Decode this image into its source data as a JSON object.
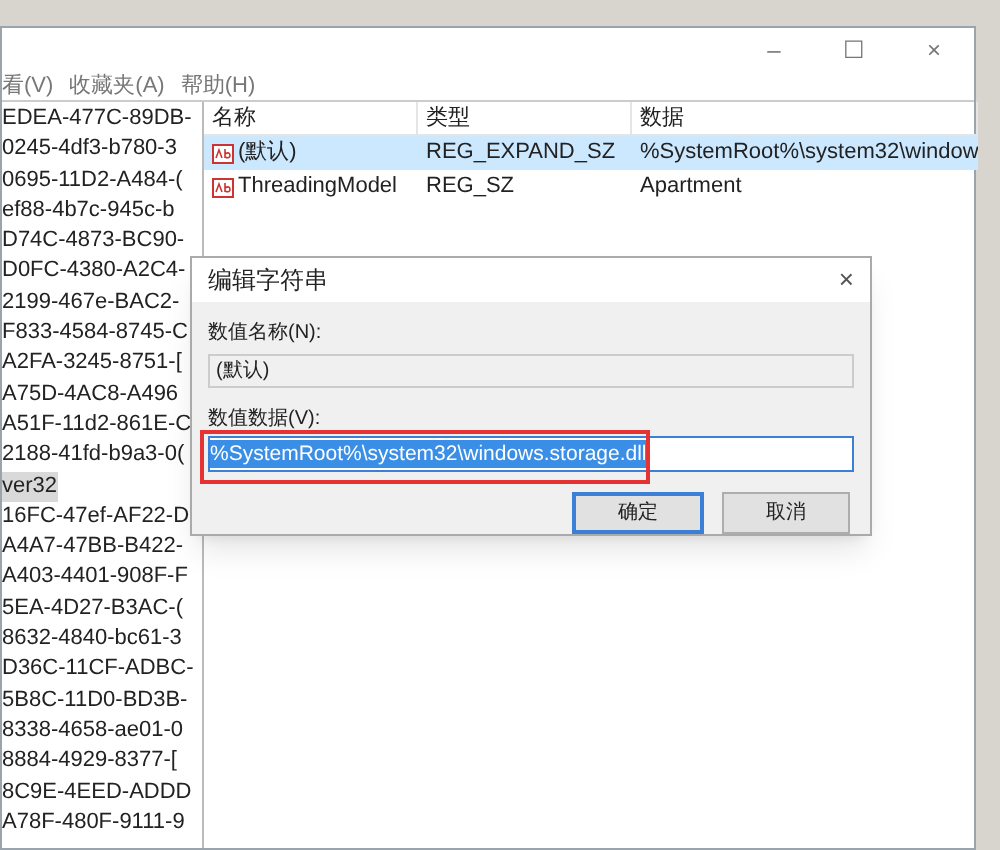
{
  "window": {
    "controls": [
      "–",
      "☐",
      "×"
    ]
  },
  "menu": [
    "看(V)",
    "收藏夹(A)",
    "帮助(H)"
  ],
  "tree": [
    {
      "label": "EDEA-477C-89DB-",
      "selected": false
    },
    {
      "label": "0245-4df3-b780-3",
      "selected": false
    },
    {
      "label": "0695-11D2-A484-(",
      "selected": false
    },
    {
      "label": "ef88-4b7c-945c-b",
      "selected": false
    },
    {
      "label": "D74C-4873-BC90-",
      "selected": false
    },
    {
      "label": "D0FC-4380-A2C4-",
      "selected": false
    },
    {
      "label": "2199-467e-BAC2-",
      "selected": false
    },
    {
      "label": "F833-4584-8745-C",
      "selected": false
    },
    {
      "label": "A2FA-3245-8751-[",
      "selected": false
    },
    {
      "label": "A75D-4AC8-A496",
      "selected": false
    },
    {
      "label": "A51F-11d2-861E-C",
      "selected": false
    },
    {
      "label": "2188-41fd-b9a3-0(",
      "selected": false
    },
    {
      "label": "ver32",
      "selected": true
    },
    {
      "label": "16FC-47ef-AF22-D",
      "selected": false
    },
    {
      "label": "A4A7-47BB-B422-",
      "selected": false
    },
    {
      "label": "A403-4401-908F-F",
      "selected": false
    },
    {
      "label": "5EA-4D27-B3AC-(",
      "selected": false
    },
    {
      "label": "8632-4840-bc61-3",
      "selected": false
    },
    {
      "label": "D36C-11CF-ADBC-",
      "selected": false
    },
    {
      "label": "5B8C-11D0-BD3B-",
      "selected": false
    },
    {
      "label": "8338-4658-ae01-0",
      "selected": false
    },
    {
      "label": "8884-4929-8377-[",
      "selected": false
    },
    {
      "label": "8C9E-4EED-ADDD",
      "selected": false
    },
    {
      "label": "A78F-480F-9111-9",
      "selected": false
    }
  ],
  "table": {
    "columns": [
      "名称",
      "类型",
      "数据"
    ],
    "rows": [
      {
        "name": "(默认)",
        "type": "REG_EXPAND_SZ",
        "data": "%SystemRoot%\\system32\\window",
        "selected": true
      },
      {
        "name": "ThreadingModel",
        "type": "REG_SZ",
        "data": "Apartment",
        "selected": false
      }
    ]
  },
  "dialog": {
    "title": "编辑字符串",
    "close": "×",
    "name_label": "数值名称(N):",
    "name_value": "(默认)",
    "data_label": "数值数据(V):",
    "data_value": "%SystemRoot%\\system32\\windows.storage.dll",
    "ok": "确定",
    "cancel": "取消"
  }
}
